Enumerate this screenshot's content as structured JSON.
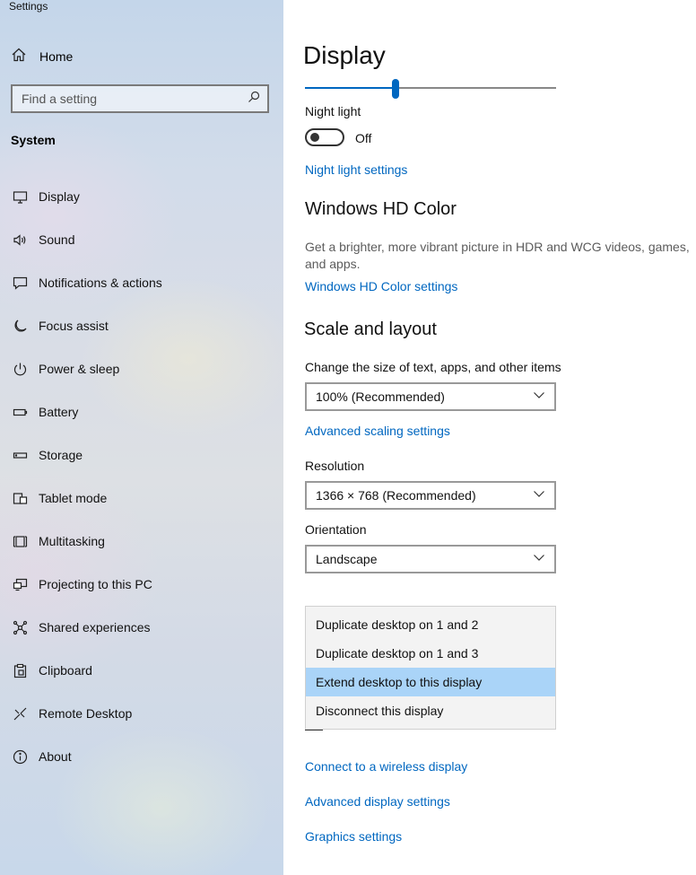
{
  "window": {
    "title": "Settings"
  },
  "sidebar": {
    "home_label": "Home",
    "search_placeholder": "Find a setting",
    "section_label": "System",
    "items": [
      {
        "label": "Display",
        "icon": "monitor-icon"
      },
      {
        "label": "Sound",
        "icon": "speaker-icon"
      },
      {
        "label": "Notifications & actions",
        "icon": "notification-icon"
      },
      {
        "label": "Focus assist",
        "icon": "moon-icon"
      },
      {
        "label": "Power & sleep",
        "icon": "power-icon"
      },
      {
        "label": "Battery",
        "icon": "battery-icon"
      },
      {
        "label": "Storage",
        "icon": "storage-icon"
      },
      {
        "label": "Tablet mode",
        "icon": "tablet-icon"
      },
      {
        "label": "Multitasking",
        "icon": "multitasking-icon"
      },
      {
        "label": "Projecting to this PC",
        "icon": "projecting-icon"
      },
      {
        "label": "Shared experiences",
        "icon": "shared-icon"
      },
      {
        "label": "Clipboard",
        "icon": "clipboard-icon"
      },
      {
        "label": "Remote Desktop",
        "icon": "remote-icon"
      },
      {
        "label": "About",
        "icon": "info-icon"
      }
    ]
  },
  "main": {
    "title": "Display",
    "brightness": {
      "value_fraction": 0.36
    },
    "night_light": {
      "label": "Night light",
      "state": "Off",
      "settings_link": "Night light settings"
    },
    "hd_color": {
      "heading": "Windows HD Color",
      "description": "Get a brighter, more vibrant picture in HDR and WCG videos, games, and apps.",
      "link": "Windows HD Color settings"
    },
    "scale": {
      "heading": "Scale and layout",
      "size_label": "Change the size of text, apps, and other items",
      "size_value": "100% (Recommended)",
      "advanced_link": "Advanced scaling settings",
      "resolution_label": "Resolution",
      "resolution_value": "1366 × 768 (Recommended)",
      "orientation_label": "Orientation",
      "orientation_value": "Landscape"
    },
    "multiple_displays": {
      "options": [
        "Duplicate desktop on 1 and 2",
        "Duplicate desktop on 1 and 3",
        "Extend desktop to this display",
        "Disconnect this display"
      ],
      "selected_index": 2
    },
    "links": {
      "wireless": "Connect to a wireless display",
      "advanced_display": "Advanced display settings",
      "graphics": "Graphics settings"
    }
  },
  "colors": {
    "accent": "#0067c0",
    "selected_option": "#aad4f8"
  }
}
